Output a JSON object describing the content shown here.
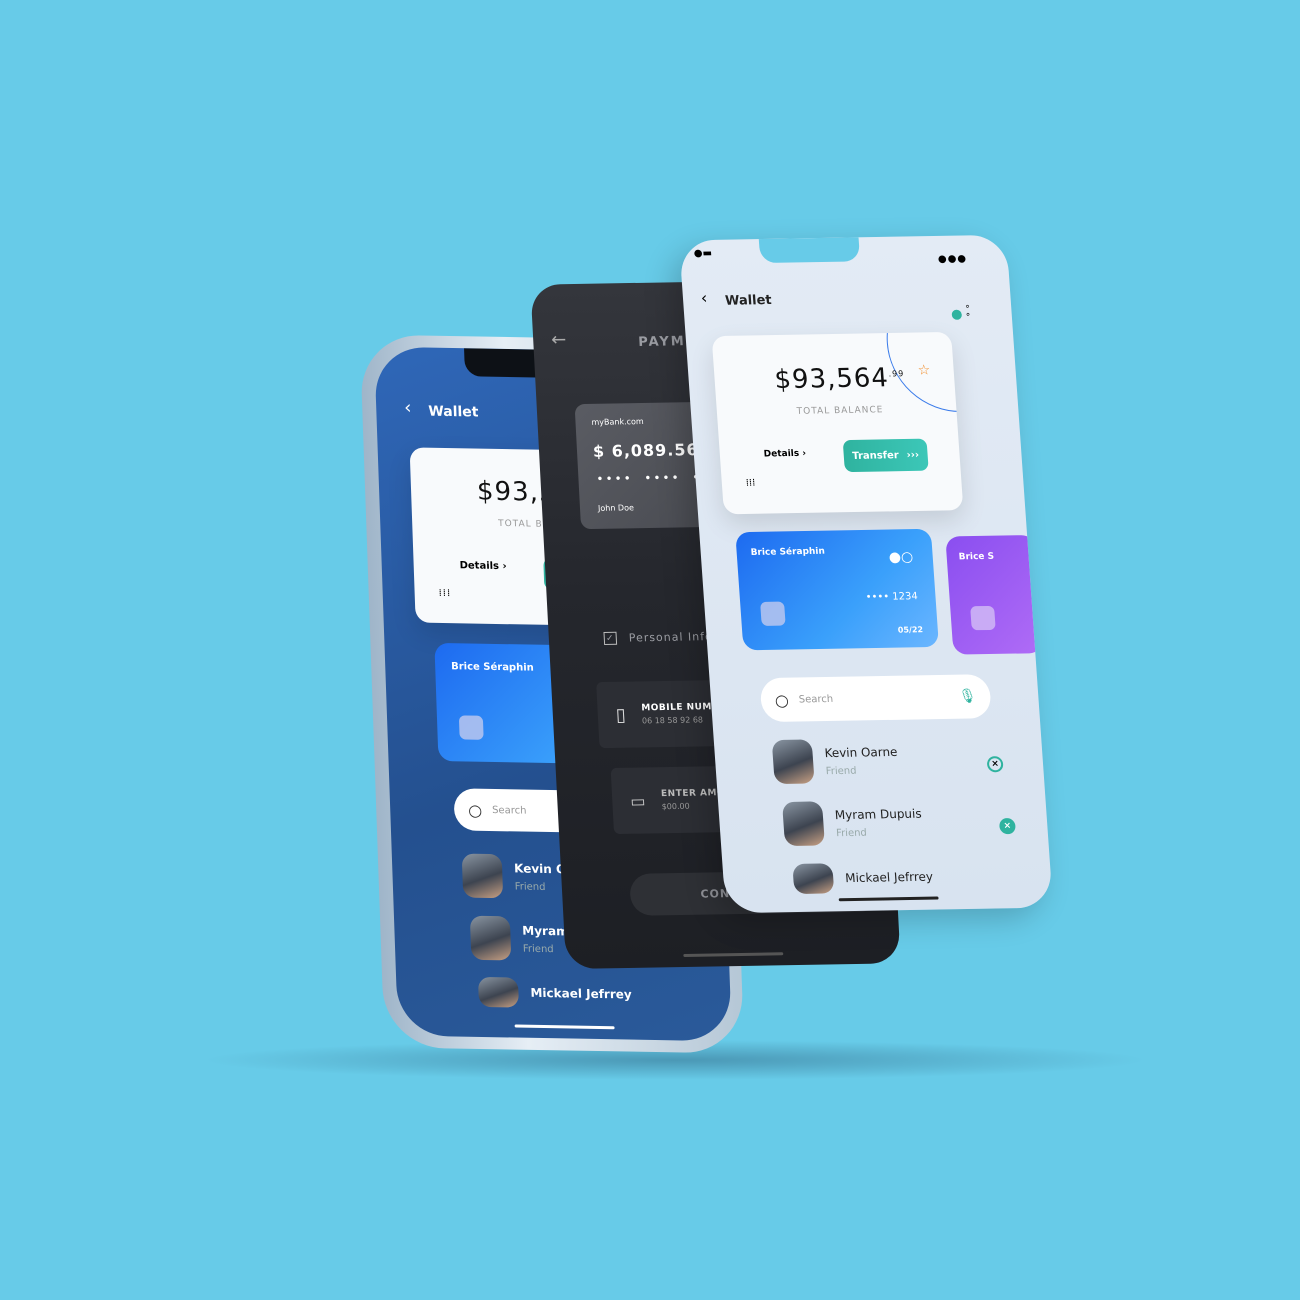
{
  "colors": {
    "background": "#67cbe8",
    "accent_teal": "#2fb39f",
    "card_blue": "#1d6af0",
    "card_purple": "#9b5cf0",
    "star": "#f28c28"
  },
  "wallet_blue": {
    "title": "Wallet",
    "balance": "$93,56",
    "balance_label": "TOTAL BALANCE",
    "details": "Details",
    "transfer": "Tr",
    "card_holder": "Brice Séraphin",
    "card_dots": "•••",
    "search_placeholder": "Search",
    "contacts": [
      {
        "name": "Kevin Oarne",
        "role": "Friend"
      },
      {
        "name": "Myram Dupuis",
        "role": "Friend"
      },
      {
        "name": "Mickael Jefrrey"
      }
    ]
  },
  "payment_dark": {
    "title": "PAYMENT",
    "bank": "myBank.com",
    "amount": "$ 6,089.56",
    "card_number": "••••  ••••  •••",
    "holder": "John Doe",
    "personal_info": "Personal Information",
    "mobile_label": "MOBILE NUMBER",
    "mobile_value": "06 18 58 92 68",
    "amount_label": "ENTER AMOUNT",
    "amount_value": "$00.00",
    "confirm": "CONFIRM NOW!"
  },
  "wallet_light": {
    "title": "Wallet",
    "balance": "$93,564",
    "balance_cents": ".99",
    "balance_label": "TOTAL BALANCE",
    "details": "Details",
    "transfer": "Transfer",
    "cards": [
      {
        "holder": "Brice Séraphin",
        "last4": "•••• 1234",
        "expiry": "05/22"
      },
      {
        "holder": "Brice S"
      }
    ],
    "search_placeholder": "Search",
    "contacts": [
      {
        "name": "Kevin Oarne",
        "role": "Friend"
      },
      {
        "name": "Myram Dupuis",
        "role": "Friend"
      },
      {
        "name": "Mickael Jefrrey"
      }
    ]
  }
}
